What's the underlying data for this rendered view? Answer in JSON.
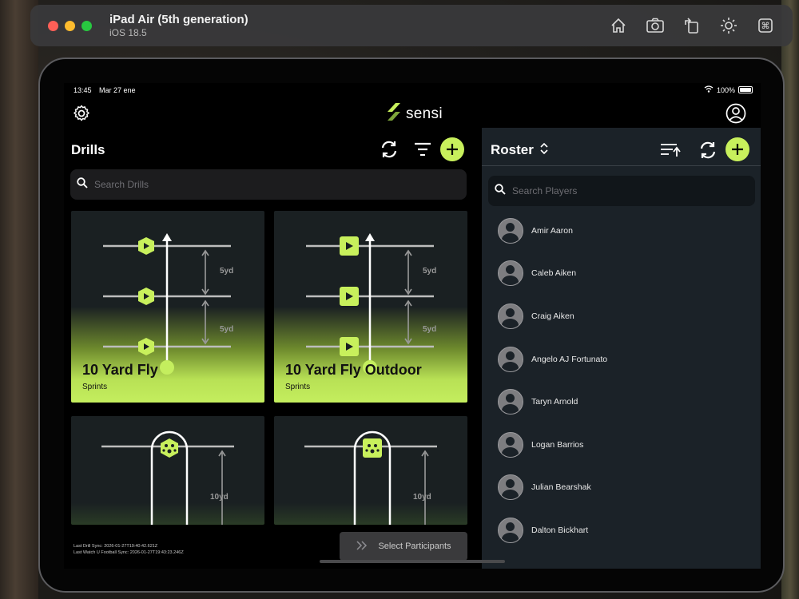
{
  "simulator": {
    "title": "iPad Air (5th generation)",
    "subtitle": "iOS 18.5",
    "toolbar_icons": [
      "home-icon",
      "screenshot-icon",
      "rotate-icon",
      "appearance-icon",
      "command-icon"
    ]
  },
  "status_bar": {
    "time": "13:45",
    "date": "Mar 27 ene",
    "battery": "100%"
  },
  "app": {
    "logo_text": "sensi",
    "accent": "#c8f05c",
    "panel_bg": "#1b2228"
  },
  "drills": {
    "title": "Drills",
    "search_placeholder": "Search Drills",
    "cards": [
      {
        "title": "10 Yard Fly",
        "category": "Sprints",
        "distance_1": "5yd",
        "distance_2": "5yd"
      },
      {
        "title": "10 Yard Fly Outdoor",
        "category": "Sprints",
        "distance_1": "5yd",
        "distance_2": "5yd"
      },
      {
        "distance_1": "10yd"
      },
      {
        "distance_1": "10yd"
      }
    ],
    "sync_line_1": "Last Drill Sync: 2026-01-27T19:40:42.621Z",
    "sync_line_2": "Last Watch U Football Sync: 2026-01-27T19:43:23.246Z",
    "select_participants": "Select Participants"
  },
  "roster": {
    "title": "Roster",
    "search_placeholder": "Search Players",
    "players": [
      "Amir Aaron",
      "Caleb Aiken",
      "Craig Aiken",
      "Angelo AJ Fortunato",
      "Taryn Arnold",
      "Logan Barrios",
      "Julian Bearshak",
      "Dalton Bickhart"
    ]
  }
}
